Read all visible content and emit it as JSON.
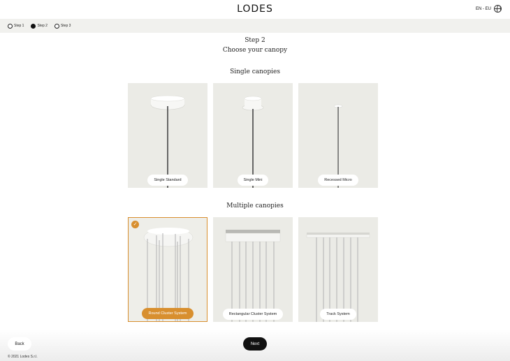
{
  "brand": {
    "logo": "LODES"
  },
  "language": {
    "label": "EN - EU",
    "icon": "globe-icon"
  },
  "steps": [
    {
      "label": "Step 1",
      "active": false
    },
    {
      "label": "Step 2",
      "active": true
    },
    {
      "label": "Step 3",
      "active": false
    }
  ],
  "main": {
    "step_title": "Step 2",
    "subtitle": "Choose your canopy",
    "sections": [
      {
        "title": "Single canopies",
        "options": [
          {
            "label": "Single Standard",
            "selected": false
          },
          {
            "label": "Single Mini",
            "selected": false
          },
          {
            "label": "Recessed Micro",
            "selected": false
          }
        ]
      },
      {
        "title": "Multiple canopies",
        "options": [
          {
            "label": "Round Cluster System",
            "selected": true
          },
          {
            "label": "Rectangular Cluster System",
            "selected": false
          },
          {
            "label": "Track System",
            "selected": false
          }
        ]
      }
    ]
  },
  "footer": {
    "back_label": "Back",
    "next_label": "Next",
    "copyright": "© 2021 Lodes S.r.l."
  },
  "colors": {
    "accent": "#d88f2f",
    "card_bg": "#ebebe6",
    "steps_bar_bg": "#f1f1ee"
  }
}
